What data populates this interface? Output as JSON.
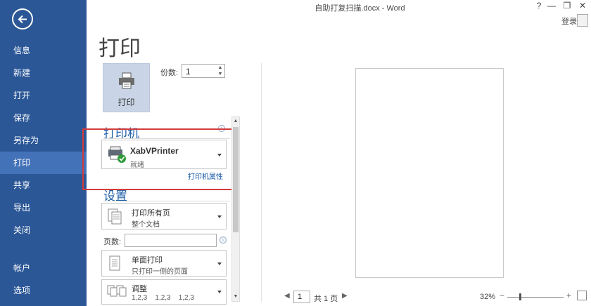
{
  "window": {
    "title": "自助打复扫描.docx - Word",
    "help": "?",
    "minimize": "—",
    "restore": "❐",
    "close": "✕",
    "login": "登录"
  },
  "sidebar": {
    "items": [
      {
        "label": "信息"
      },
      {
        "label": "新建"
      },
      {
        "label": "打开"
      },
      {
        "label": "保存"
      },
      {
        "label": "另存为"
      },
      {
        "label": "打印",
        "active": true
      },
      {
        "label": "共享"
      },
      {
        "label": "导出"
      },
      {
        "label": "关闭"
      },
      {
        "label": "帐户"
      },
      {
        "label": "选项"
      }
    ],
    "colors": {
      "bg": "#2b5797",
      "active": "#4472b8"
    }
  },
  "page": {
    "title": "打印",
    "print_button": "打印",
    "copies_label": "份数:",
    "copies_value": "1"
  },
  "printer": {
    "section": "打印机",
    "name": "XabVPrinter",
    "status": "就绪",
    "properties_link": "打印机属性"
  },
  "settings": {
    "section": "设置",
    "range": {
      "line1": "打印所有页",
      "line2": "整个文档"
    },
    "pages_label": "页数:",
    "pages_value": "",
    "sides": {
      "line1": "单面打印",
      "line2": "只打印一侧的页面"
    },
    "collate": {
      "line1": "调整",
      "line2": "1,2,3    1,2,3    1,2,3"
    }
  },
  "preview_nav": {
    "prev": "◀",
    "page_value": "1",
    "total": "共 1 页",
    "next": "▶"
  },
  "zoom": {
    "percent": "32%",
    "minus": "−",
    "plus": "+"
  },
  "accent": "#1e5fa8",
  "highlight_color": "#d33b3b"
}
